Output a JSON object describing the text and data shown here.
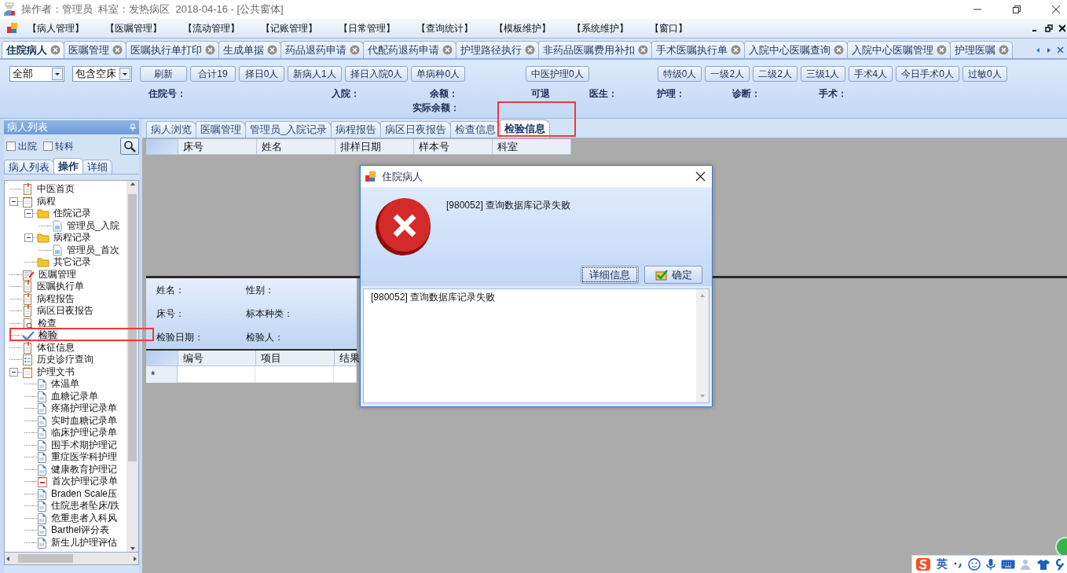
{
  "window": {
    "title": "操作者：管理员  科室：发热病区  2018-04-16 - [公共窗体]"
  },
  "menu": [
    "【病人管理】",
    "【医嘱管理】",
    "【流动管理】",
    "【记账管理】",
    "【日常管理】",
    "【查询统计】",
    "【模板维护】",
    "【系统维护】",
    "【窗口】"
  ],
  "doc_tabs": [
    {
      "label": "住院病人",
      "selected": true
    },
    {
      "label": "医嘱管理",
      "selected": false
    },
    {
      "label": "医嘱执行单打印",
      "selected": false
    },
    {
      "label": "生成单据",
      "selected": false
    },
    {
      "label": "药品退药申请",
      "selected": false
    },
    {
      "label": "代配药退药申请",
      "selected": false
    },
    {
      "label": "护理路径执行",
      "selected": false
    },
    {
      "label": "非药品医嘱费用补扣",
      "selected": false
    },
    {
      "label": "手术医嘱执行单",
      "selected": false
    },
    {
      "label": "入院中心医嘱查询",
      "selected": false
    },
    {
      "label": "入院中心医嘱管理",
      "selected": false
    },
    {
      "label": "护理医嘱",
      "selected": false
    }
  ],
  "toolbar": {
    "dropdowns": [
      {
        "value": "全部"
      },
      {
        "value": "包含空床"
      }
    ],
    "count_buttons": [
      "刷新",
      "合计19",
      "择日0人",
      "新病人1人",
      "择日入院0人",
      "单病种0人"
    ],
    "nursing_button": "中医护理0人",
    "level_buttons": [
      "特级0人",
      "一级2人",
      "二级2人",
      "三级1人",
      "手术4人",
      "今日手术0人",
      "过敏0人"
    ]
  },
  "patient_info": {
    "row_1": [
      "住院号：",
      "入院：",
      "余额：",
      "可退",
      "医生：",
      "护理：",
      "诊断：",
      "手术："
    ],
    "row_2": [
      "实际余额："
    ]
  },
  "side_panel": {
    "title": "病人列表",
    "checkboxes": [
      {
        "label": "出院",
        "checked": false
      },
      {
        "label": "转科",
        "checked": false
      }
    ],
    "tabs": [
      {
        "label": "病人列表",
        "selected": false
      },
      {
        "label": "操作",
        "selected": true
      },
      {
        "label": "详细",
        "selected": false
      }
    ],
    "tree": [
      {
        "label": "中医首页",
        "kind": "note",
        "selected": false
      },
      {
        "label": "病程",
        "kind": "notepad",
        "selected": false,
        "expanded": true,
        "children": [
          {
            "label": "住院记录",
            "kind": "folder",
            "selected": false,
            "expanded": true,
            "children": [
              {
                "label": "管理员_入院",
                "kind": "file",
                "selected": false
              }
            ]
          },
          {
            "label": "病程记录",
            "kind": "folder",
            "selected": false,
            "expanded": true,
            "children": [
              {
                "label": "管理员_首次",
                "kind": "file",
                "selected": false
              }
            ]
          },
          {
            "label": "其它记录",
            "kind": "folder",
            "selected": false
          }
        ]
      },
      {
        "label": "医嘱管理",
        "kind": "edit",
        "selected": false
      },
      {
        "label": "医嘱执行单",
        "kind": "note",
        "selected": false
      },
      {
        "label": "病程报告",
        "kind": "note",
        "selected": false
      },
      {
        "label": "病区日夜报告",
        "kind": "note",
        "selected": false
      },
      {
        "label": "检查",
        "kind": "search",
        "selected": false
      },
      {
        "label": "检验",
        "kind": "check",
        "selected": true
      },
      {
        "label": "体征信息",
        "kind": "note",
        "selected": false
      },
      {
        "label": "历史诊疗查询",
        "kind": "clipboard",
        "selected": false
      },
      {
        "label": "护理文书",
        "kind": "notepad",
        "selected": false,
        "expanded": true,
        "children": [
          {
            "label": "体温单",
            "kind": "doc",
            "selected": false
          },
          {
            "label": "血糖记录单",
            "kind": "doc",
            "selected": false
          },
          {
            "label": "疼痛护理记录单",
            "kind": "doc",
            "selected": false
          },
          {
            "label": "实时血糖记录单",
            "kind": "doc",
            "selected": false
          },
          {
            "label": "临床护理记录单",
            "kind": "doc",
            "selected": false
          },
          {
            "label": "围手术期护理记",
            "kind": "doc",
            "selected": false
          },
          {
            "label": "重症医学科护理",
            "kind": "doc",
            "selected": false
          },
          {
            "label": "健康教育护理记",
            "kind": "doc",
            "selected": false
          },
          {
            "label": "首次护理记录单",
            "kind": "calendar",
            "selected": false
          },
          {
            "label": "Braden Scale压",
            "kind": "doc",
            "selected": false
          },
          {
            "label": "住院患者坠床/跌",
            "kind": "doc",
            "selected": false
          },
          {
            "label": "危重患者入科风",
            "kind": "doc",
            "selected": false
          },
          {
            "label": "Barthel评分表",
            "kind": "doc",
            "selected": false
          },
          {
            "label": "新生儿护理评估",
            "kind": "doc",
            "selected": false
          }
        ]
      }
    ]
  },
  "record_tabs": [
    {
      "label": "病人浏览",
      "selected": false
    },
    {
      "label": "医嘱管理",
      "selected": false
    },
    {
      "label": "管理员_入院记录",
      "selected": false
    },
    {
      "label": "病程报告",
      "selected": false
    },
    {
      "label": "病区日夜报告",
      "selected": false
    },
    {
      "label": "检查信息",
      "selected": false
    },
    {
      "label": "检验信息",
      "selected": true
    }
  ],
  "sample_table": {
    "columns": [
      "床号",
      "姓名",
      "排样日期",
      "样本号",
      "科室"
    ]
  },
  "sample_detail": {
    "labels": [
      "姓名：",
      "性别：",
      "床号：",
      "标本种类：",
      "检验日期：",
      "检验人："
    ]
  },
  "result_table": {
    "columns": [
      "编号",
      "项目",
      "结果"
    ],
    "new_row_marker": "*"
  },
  "dialog": {
    "title": "住院病人",
    "message": "[980052] 查询数据库记录失败",
    "buttons": [
      {
        "label": "详细信息",
        "kind": "plain",
        "focused": true
      },
      {
        "label": "确定",
        "kind": "ok",
        "focused": false
      }
    ],
    "details": "[980052] 查询数据库记录失败"
  },
  "ime_bar": {
    "mode": "英"
  }
}
